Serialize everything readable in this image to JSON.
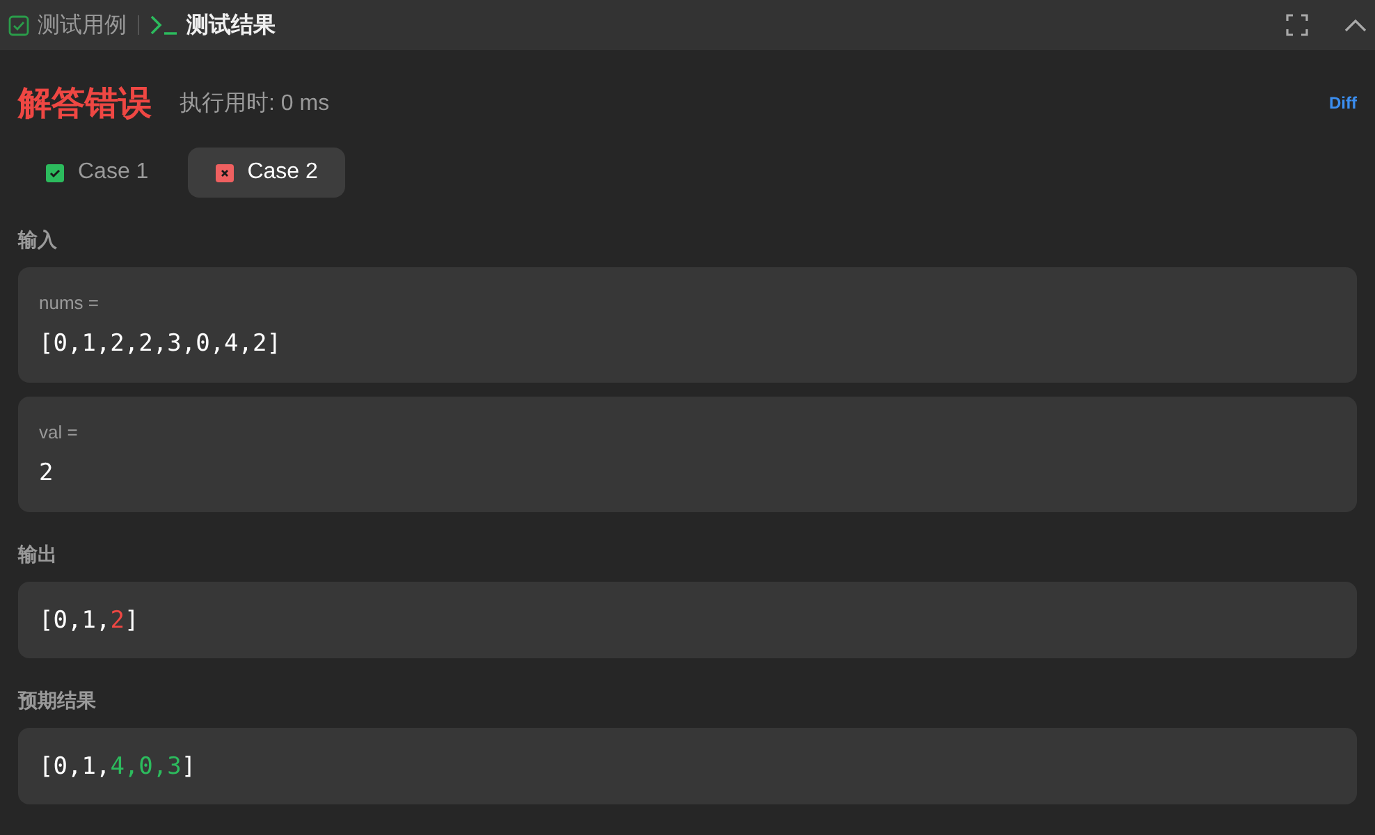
{
  "header": {
    "tabs": [
      {
        "label": "测试用例",
        "kind": "testcase",
        "selected": false
      },
      {
        "label": "测试结果",
        "kind": "result",
        "selected": true
      }
    ]
  },
  "result": {
    "status": "解答错误",
    "accepted": false,
    "runtime": "执行用时: 0 ms",
    "diff": "Diff"
  },
  "cases": [
    {
      "label": "Case 1",
      "passed": true,
      "selected": false
    },
    {
      "label": "Case 2",
      "passed": false,
      "selected": true
    }
  ],
  "input": {
    "title": "输入",
    "params": [
      {
        "name": "nums =",
        "value": "[0,1,2,2,3,0,4,2]"
      },
      {
        "name": "val =",
        "value": "2"
      }
    ]
  },
  "output": {
    "title": "输出",
    "segments": [
      {
        "text": "[0,1,",
        "kind": "plain"
      },
      {
        "text": "2",
        "kind": "removed"
      },
      {
        "text": "]",
        "kind": "plain"
      }
    ]
  },
  "expected": {
    "title": "预期结果",
    "segments": [
      {
        "text": "[0,1,",
        "kind": "plain"
      },
      {
        "text": "4,0,3",
        "kind": "added"
      },
      {
        "text": "]",
        "kind": "plain"
      }
    ]
  }
}
